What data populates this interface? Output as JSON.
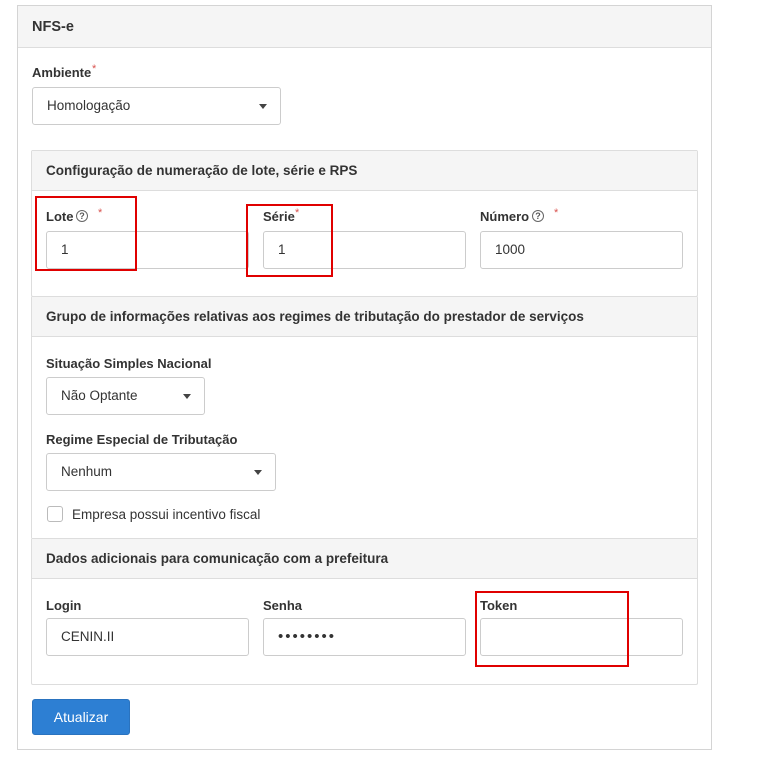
{
  "panel": {
    "title": "NFS-e"
  },
  "ambiente": {
    "label": "Ambiente",
    "required_mark": "*",
    "value": "Homologação"
  },
  "numeracao": {
    "title": "Configuração de numeração de lote, série e RPS",
    "lote": {
      "label": "Lote",
      "required_mark": "*",
      "value": "1"
    },
    "serie": {
      "label": "Série",
      "required_mark": "*",
      "value": "1"
    },
    "numero": {
      "label": "Número",
      "required_mark": "*",
      "value": "1000"
    }
  },
  "tributacao": {
    "title": "Grupo de informações relativas aos regimes de tributação do prestador de serviços",
    "simples": {
      "label": "Situação Simples Nacional",
      "value": "Não Optante"
    },
    "regime": {
      "label": "Regime Especial de Tributação",
      "value": "Nenhum"
    },
    "incentivo": {
      "label": "Empresa possui incentivo fiscal",
      "checked": false
    }
  },
  "prefeitura": {
    "title": "Dados adicionais para comunicação com a prefeitura",
    "login": {
      "label": "Login",
      "value": "CENIN.II"
    },
    "senha": {
      "label": "Senha",
      "value": "••••••••"
    },
    "token": {
      "label": "Token",
      "value": ""
    }
  },
  "actions": {
    "update_label": "Atualizar"
  },
  "colors": {
    "primary_button": "#2d7fd3",
    "highlight_box": "#e00000",
    "required": "#d9534f"
  }
}
